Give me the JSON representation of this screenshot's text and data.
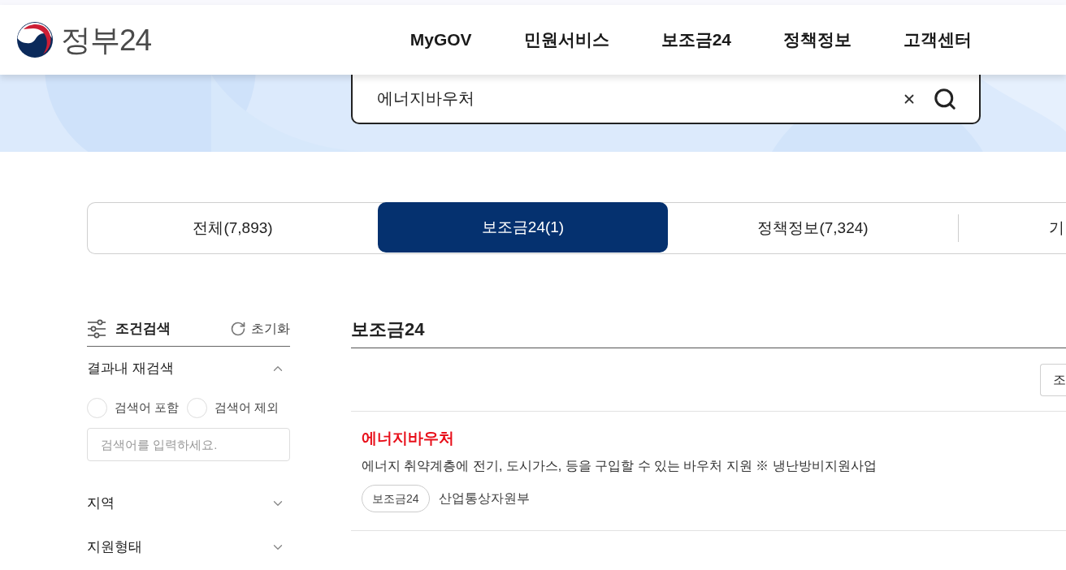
{
  "header": {
    "logo_text": "정부24",
    "nav": [
      "MyGOV",
      "민원서비스",
      "보조금24",
      "정책정보",
      "고객센터"
    ]
  },
  "search": {
    "value": "에너지바우처"
  },
  "tabs": [
    {
      "label": "전체(7,893)",
      "selected": false
    },
    {
      "label": "보조금24(1)",
      "selected": true
    },
    {
      "label": "정책정보(7,324)",
      "selected": false
    },
    {
      "label": "기",
      "selected": false
    }
  ],
  "sidebar": {
    "title": "조건검색",
    "reset": "초기화",
    "sections": [
      {
        "title": "결과내 재검색",
        "expanded": true,
        "options": [
          {
            "label": "검색어 포함",
            "selected": false
          },
          {
            "label": "검색어 제외",
            "selected": false
          }
        ],
        "input": {
          "placeholder": "검색어를 입력하세요."
        }
      },
      {
        "title": "지역",
        "expanded": false
      },
      {
        "title": "지원형태",
        "expanded": false
      }
    ]
  },
  "results": {
    "title": "보조금24",
    "toolbar_button": "조",
    "items": [
      {
        "title": "에너지바우처",
        "description": "에너지 취약계층에 전기, 도시가스, 등을 구입할 수 있는 바우처 지원 ※ 냉난방비지원사업",
        "tag": "보조금24",
        "agency": "산업통상자원부"
      }
    ]
  }
}
